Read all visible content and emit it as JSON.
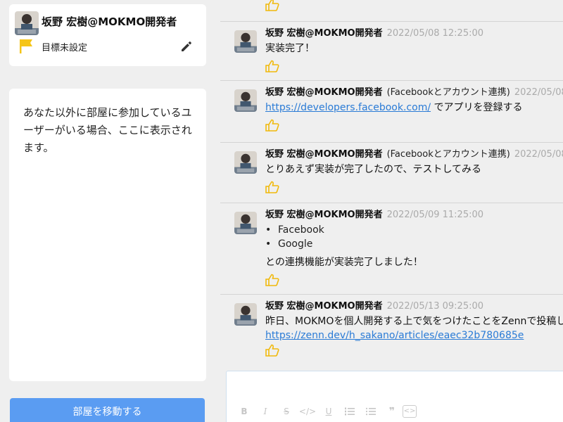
{
  "profile": {
    "name": "坂野 宏樹@MOKMO開発者",
    "goal": "目標未設定"
  },
  "members": {
    "empty_message": "あなた以外に部屋に参加しているユーザーがいる場合、ここに表示されます。"
  },
  "actions": {
    "move_room": "部屋を移動する"
  },
  "messages": [
    {
      "author": "坂野 宏樹@MOKMO開発者",
      "context": "",
      "time": "2022/05/08 12:25:00",
      "text": "実装完了！"
    },
    {
      "author": "坂野 宏樹@MOKMO開発者",
      "context": "(Facebookとアカウント連携)",
      "time": "2022/05/08",
      "link": "https://developers.facebook.com/",
      "text": " でアプリを登録する"
    },
    {
      "author": "坂野 宏樹@MOKMO開発者",
      "context": "(Facebookとアカウント連携)",
      "time": "2022/05/08",
      "text": "とりあえず実装が完了したので、テストしてみる"
    },
    {
      "author": "坂野 宏樹@MOKMO開発者",
      "context": "",
      "time": "2022/05/09 11:25:00",
      "bullets": [
        "Facebook",
        "Google"
      ],
      "text": "との連携機能が実装完了しました！"
    },
    {
      "author": "坂野 宏樹@MOKMO開発者",
      "context": "",
      "time": "2022/05/13 09:25:00",
      "text": "昨日、MOKMOを個人開発する上で気をつけたことをZennで投稿しました",
      "link": "https://zenn.dev/h_sakano/articles/eaec32b780685e"
    }
  ],
  "editor": {
    "tools": [
      "B",
      "I",
      "S",
      "</>",
      "U",
      "ol",
      "ul",
      "quote",
      "code-block"
    ]
  },
  "colors": {
    "accent": "#5a9cf2",
    "link": "#2a7bd6",
    "like": "#f0b90b",
    "flag": "#f5c518"
  }
}
